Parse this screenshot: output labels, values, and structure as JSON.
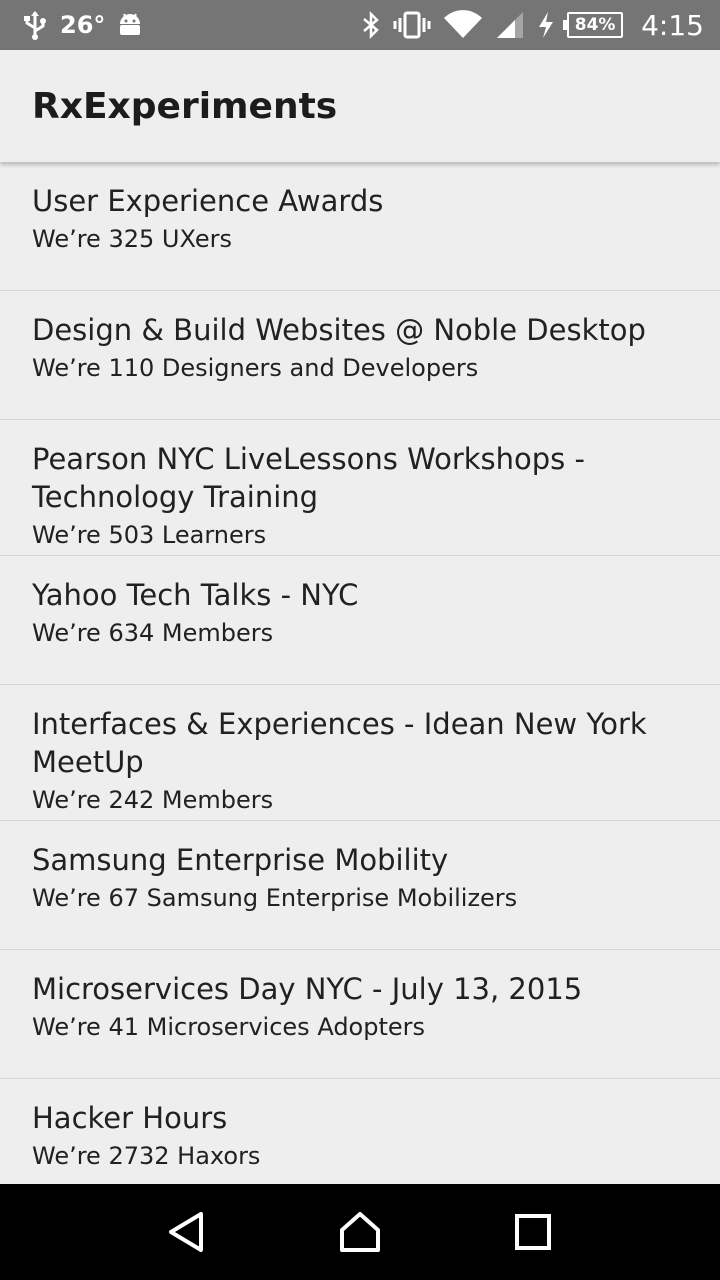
{
  "status_bar": {
    "temperature": "26°",
    "battery": "84%",
    "time": "4:15",
    "icons": [
      "usb-icon",
      "android-icon",
      "bluetooth-icon",
      "vibrate-icon",
      "wifi-icon",
      "signal-icon",
      "charging-icon",
      "battery-icon"
    ]
  },
  "app_bar": {
    "title": "RxExperiments"
  },
  "groups": [
    {
      "title": "User Experience Awards",
      "subtitle": "We’re 325 UXers"
    },
    {
      "title": "Design & Build Websites @ Noble Desktop",
      "subtitle": "We’re 110 Designers and Developers"
    },
    {
      "title": "Pearson NYC LiveLessons Workshops - Technology Training",
      "subtitle": "We’re 503 Learners"
    },
    {
      "title": "Yahoo Tech Talks - NYC",
      "subtitle": "We’re 634 Members"
    },
    {
      "title": "Interfaces & Experiences - Idean New York MeetUp",
      "subtitle": "We’re 242 Members"
    },
    {
      "title": "Samsung Enterprise Mobility",
      "subtitle": "We’re 67 Samsung Enterprise Mobilizers"
    },
    {
      "title": "Microservices Day NYC - July 13, 2015",
      "subtitle": "We’re 41 Microservices Adopters"
    },
    {
      "title": "Hacker Hours",
      "subtitle": "We’re 2732 Haxors"
    }
  ],
  "nav_bar": {
    "icons": [
      "back-icon",
      "home-icon",
      "recents-icon"
    ]
  }
}
